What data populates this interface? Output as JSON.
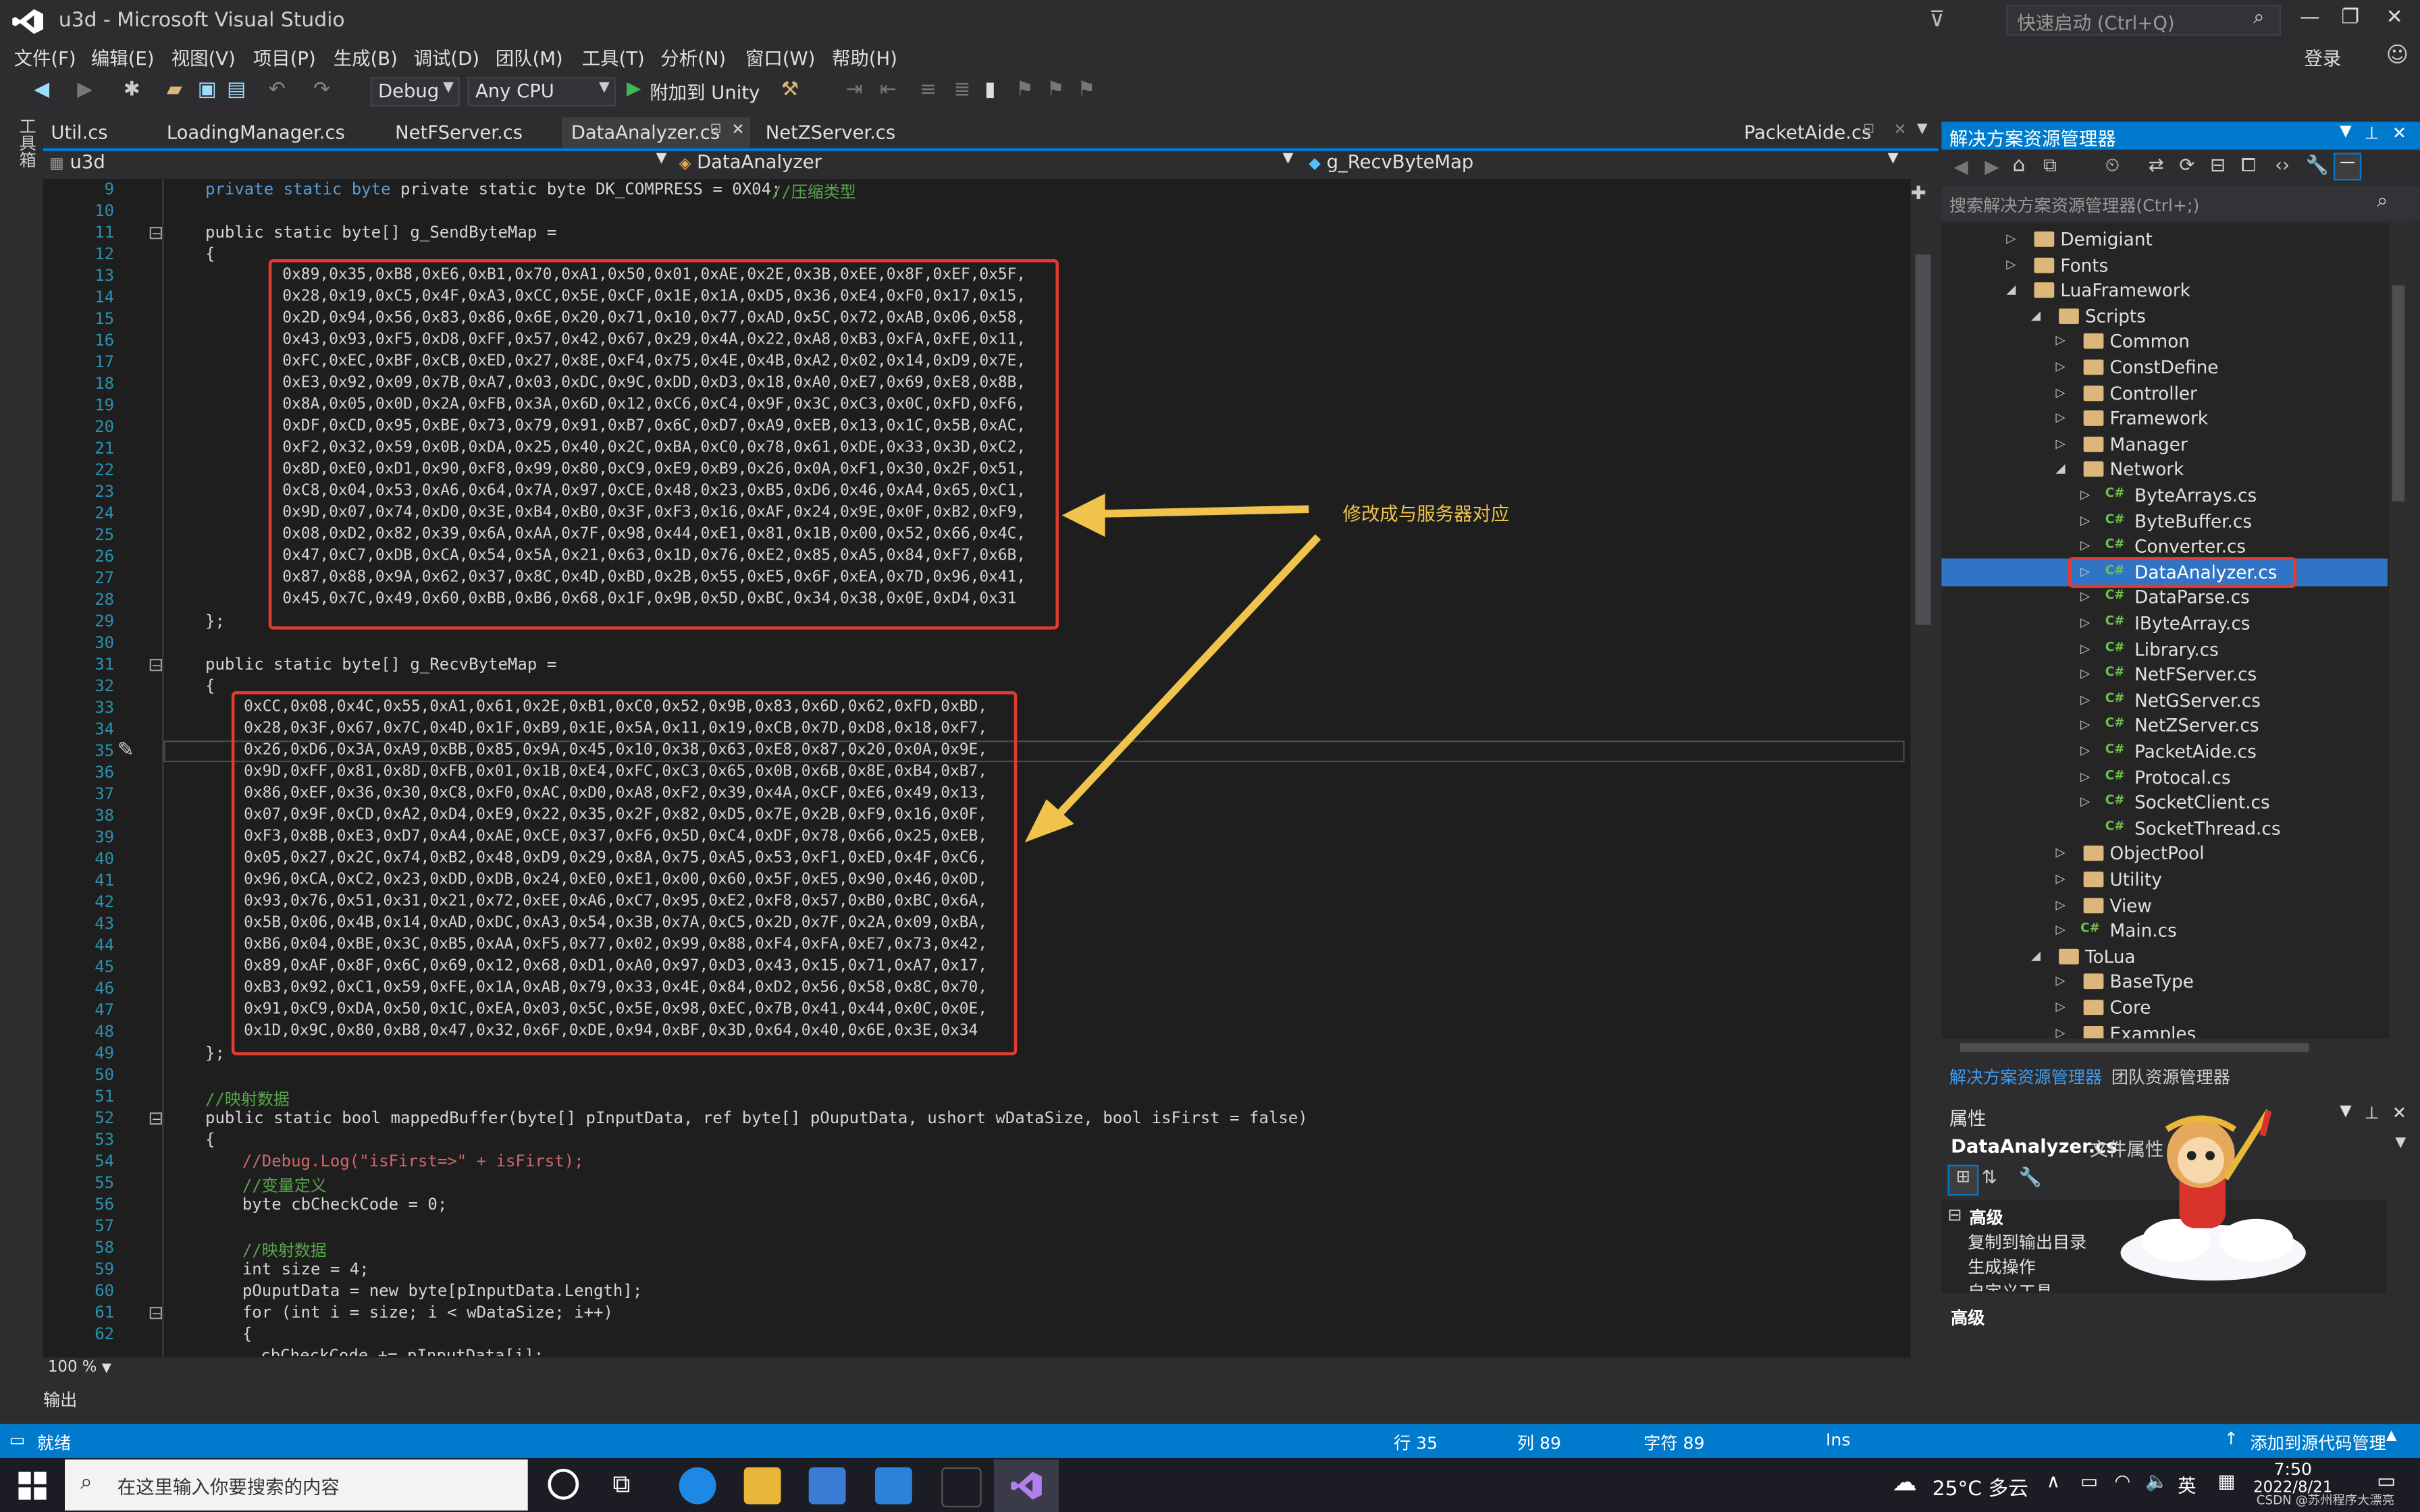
{
  "window": {
    "title": "u3d - Microsoft Visual Studio",
    "quick_launch_placeholder": "快速启动 (Ctrl+Q)",
    "login": "登录"
  },
  "menu": [
    "文件(F)",
    "编辑(E)",
    "视图(V)",
    "项目(P)",
    "生成(B)",
    "调试(D)",
    "团队(M)",
    "工具(T)",
    "分析(N)",
    "窗口(W)",
    "帮助(H)"
  ],
  "toolbar": {
    "config": "Debug",
    "platform": "Any CPU",
    "attach": "附加到 Unity"
  },
  "toolbox_label": "工具箱",
  "tabs": [
    "Util.cs",
    "LoadingManager.cs",
    "NetFServer.cs",
    "DataAnalyzer.cs",
    "NetZServer.cs",
    "PacketAide.cs"
  ],
  "nav": {
    "project": "u3d",
    "class": "DataAnalyzer",
    "member": "g_RecvByteMap"
  },
  "annotation": "修改成与服务器对应",
  "code": {
    "line_numbers": [
      "9",
      "10",
      "11",
      "12",
      "13",
      "14",
      "15",
      "16",
      "17",
      "18",
      "19",
      "20",
      "21",
      "22",
      "23",
      "24",
      "25",
      "26",
      "27",
      "28",
      "29",
      "30",
      "31",
      "32",
      "33",
      "34",
      "35",
      "36",
      "37",
      "38",
      "39",
      "40",
      "41",
      "42",
      "43",
      "44",
      "45",
      "46",
      "47",
      "48",
      "49",
      "50",
      "51",
      "52",
      "53",
      "54",
      "55",
      "56",
      "57",
      "58",
      "59",
      "60",
      "61",
      "62"
    ],
    "line9": "private static byte DK_COMPRESS = 0X04;",
    "line9_comment": "//压缩类型",
    "line11": "public static byte[] g_SendByteMap =",
    "line31": "public static byte[] g_RecvByteMap =",
    "open_brace": "{",
    "close_brace": "};",
    "send_map": [
      "0x89,0x35,0xB8,0xE6,0xB1,0x70,0xA1,0x50,0x01,0xAE,0x2E,0x3B,0xEE,0x8F,0xEF,0x5F,",
      "0x28,0x19,0xC5,0x4F,0xA3,0xCC,0x5E,0xCF,0x1E,0x1A,0xD5,0x36,0xE4,0xF0,0x17,0x15,",
      "0x2D,0x94,0x56,0x83,0x86,0x6E,0x20,0x71,0x10,0x77,0xAD,0x5C,0x72,0xAB,0x06,0x58,",
      "0x43,0x93,0xF5,0xD8,0xFF,0x57,0x42,0x67,0x29,0x4A,0x22,0xA8,0xB3,0xFA,0xFE,0x11,",
      "0xFC,0xEC,0xBF,0xCB,0xED,0x27,0x8E,0xF4,0x75,0x4E,0x4B,0xA2,0x02,0x14,0xD9,0x7E,",
      "0xE3,0x92,0x09,0x7B,0xA7,0x03,0xDC,0x9C,0xDD,0xD3,0x18,0xA0,0xE7,0x69,0xE8,0x8B,",
      "0x8A,0x05,0x0D,0x2A,0xFB,0x3A,0x6D,0x12,0xC6,0xC4,0x9F,0x3C,0xC3,0x0C,0xFD,0xF6,",
      "0xDF,0xCD,0x95,0xBE,0x73,0x79,0x91,0xB7,0x6C,0xD7,0xA9,0xEB,0x13,0x1C,0x5B,0xAC,",
      "0xF2,0x32,0x59,0x0B,0xDA,0x25,0x40,0x2C,0xBA,0xC0,0x78,0x61,0xDE,0x33,0x3D,0xC2,",
      "0x8D,0xE0,0xD1,0x90,0xF8,0x99,0x80,0xC9,0xE9,0xB9,0x26,0x0A,0xF1,0x30,0x2F,0x51,",
      "0xC8,0x04,0x53,0xA6,0x64,0x7A,0x97,0xCE,0x48,0x23,0xB5,0xD6,0x46,0xA4,0x65,0xC1,",
      "0x9D,0x07,0x74,0xD0,0x3E,0xB4,0xB0,0x3F,0xF3,0x16,0xAF,0x24,0x9E,0x0F,0xB2,0xF9,",
      "0x08,0xD2,0x82,0x39,0x6A,0xAA,0x7F,0x98,0x44,0xE1,0x81,0x1B,0x00,0x52,0x66,0x4C,",
      "0x47,0xC7,0xDB,0xCA,0x54,0x5A,0x21,0x63,0x1D,0x76,0xE2,0x85,0xA5,0x84,0xF7,0x6B,",
      "0x87,0x88,0x9A,0x62,0x37,0x8C,0x4D,0xBD,0x2B,0x55,0xE5,0x6F,0xEA,0x7D,0x96,0x41,",
      "0x45,0x7C,0x49,0x60,0xBB,0xB6,0x68,0x1F,0x9B,0x5D,0xBC,0x34,0x38,0x0E,0xD4,0x31"
    ],
    "recv_map": [
      "0xCC,0x08,0x4C,0x55,0xA1,0x61,0x2E,0xB1,0xC0,0x52,0x9B,0x83,0x6D,0x62,0xFD,0xBD,",
      "0x28,0x3F,0x67,0x7C,0x4D,0x1F,0xB9,0x1E,0x5A,0x11,0x19,0xCB,0x7D,0xD8,0x18,0xF7,",
      "0x26,0xD6,0x3A,0xA9,0xBB,0x85,0x9A,0x45,0x10,0x38,0x63,0xE8,0x87,0x20,0x0A,0x9E,",
      "0x9D,0xFF,0x81,0x8D,0xFB,0x01,0x1B,0xE4,0xFC,0xC3,0x65,0x0B,0x6B,0x8E,0xB4,0xB7,",
      "0x86,0xEF,0x36,0x30,0xC8,0xF0,0xAC,0xD0,0xA8,0xF2,0x39,0x4A,0xCF,0xE6,0x49,0x13,",
      "0x07,0x9F,0xCD,0xA2,0xD4,0xE9,0x22,0x35,0x2F,0x82,0xD5,0x7E,0x2B,0xF9,0x16,0x0F,",
      "0xF3,0x8B,0xE3,0xD7,0xA4,0xAE,0xCE,0x37,0xF6,0x5D,0xC4,0xDF,0x78,0x66,0x25,0xEB,",
      "0x05,0x27,0x2C,0x74,0xB2,0x48,0xD9,0x29,0x8A,0x75,0xA5,0x53,0xF1,0xED,0x4F,0xC6,",
      "0x96,0xCA,0xC2,0x23,0xDD,0xDB,0x24,0xE0,0xE1,0x00,0x60,0x5F,0xE5,0x90,0x46,0x0D,",
      "0x93,0x76,0x51,0x31,0x21,0x72,0xEE,0xA6,0xC7,0x95,0xE2,0xF8,0x57,0xB0,0xBC,0x6A,",
      "0x5B,0x06,0x4B,0x14,0xAD,0xDC,0xA3,0x54,0x3B,0x7A,0xC5,0x2D,0x7F,0x2A,0x09,0xBA,",
      "0xB6,0x04,0xBE,0x3C,0xB5,0xAA,0xF5,0x77,0x02,0x99,0x88,0xF4,0xFA,0xE7,0x73,0x42,",
      "0x89,0xAF,0x8F,0x6C,0x69,0x12,0x68,0xD1,0xA0,0x97,0xD3,0x43,0x15,0x71,0xA7,0x17,",
      "0xB3,0x92,0xC1,0x59,0xFE,0x1A,0xAB,0x79,0x33,0x4E,0x84,0xD2,0x56,0x58,0x8C,0x70,",
      "0x91,0xC9,0xDA,0x50,0x1C,0xEA,0x03,0x5C,0x5E,0x98,0xEC,0x7B,0x41,0x44,0x0C,0x0E,",
      "0x1D,0x9C,0x80,0xB8,0x47,0x32,0x6F,0xDE,0x94,0xBF,0x3D,0x64,0x40,0x6E,0x3E,0x34"
    ],
    "line51": "//映射数据",
    "line52": "public static bool mappedBuffer(byte[] pInputData, ref byte[] pOuputData, ushort wDataSize, bool isFirst = false)",
    "line54": "//Debug.Log(\"isFirst=>\" + isFirst);",
    "line55": "//变量定义",
    "line56": "byte cbCheckCode = 0;",
    "line58": "//映射数据",
    "line59": "int size = 4;",
    "line60": "pOuputData = new byte[pInputData.Length];",
    "line61": "for (int i = size; i < wDataSize; i++)",
    "line62": "{",
    "line63": "cbCheckCode += pInputData[i];"
  },
  "zoom": "100 %",
  "output_label": "输出",
  "solution": {
    "title": "解决方案资源管理器",
    "search_placeholder": "搜索解决方案资源管理器(Ctrl+;)",
    "tree": [
      "Demigiant",
      "Fonts",
      "LuaFramework",
      "Scripts",
      "Common",
      "ConstDefine",
      "Controller",
      "Framework",
      "Manager",
      "Network",
      "ByteArrays.cs",
      "ByteBuffer.cs",
      "Converter.cs",
      "DataAnalyzer.cs",
      "DataParse.cs",
      "IByteArray.cs",
      "Library.cs",
      "NetFServer.cs",
      "NetGServer.cs",
      "NetZServer.cs",
      "PacketAide.cs",
      "Protocal.cs",
      "SocketClient.cs",
      "SocketThread.cs",
      "ObjectPool",
      "Utility",
      "View",
      "Main.cs",
      "ToLua",
      "BaseType",
      "Core",
      "Examples"
    ],
    "tab_solution": "解决方案资源管理器",
    "tab_team": "团队资源管理器"
  },
  "properties": {
    "title": "属性",
    "object": "DataAnalyzer.cs",
    "object_type": "文件属性",
    "category": "高级",
    "rows": [
      "复制到输出目录",
      "生成操作",
      "自定义工具"
    ],
    "footer": "高级"
  },
  "status": {
    "ready": "就绪",
    "line": "行 35",
    "col": "列 89",
    "char": "字符 89",
    "ins": "Ins",
    "source_control": "添加到源代码管理"
  },
  "taskbar": {
    "search": "在这里输入你要搜索的内容",
    "weather": "25°C 多云",
    "ime": "英",
    "time": "7:50",
    "date": "2022/8/21",
    "watermark": "CSDN @苏州程序大漂亮"
  },
  "colors": {
    "accent": "#007acc",
    "highlight": "#e03c31",
    "annotation": "#f0c44c"
  }
}
